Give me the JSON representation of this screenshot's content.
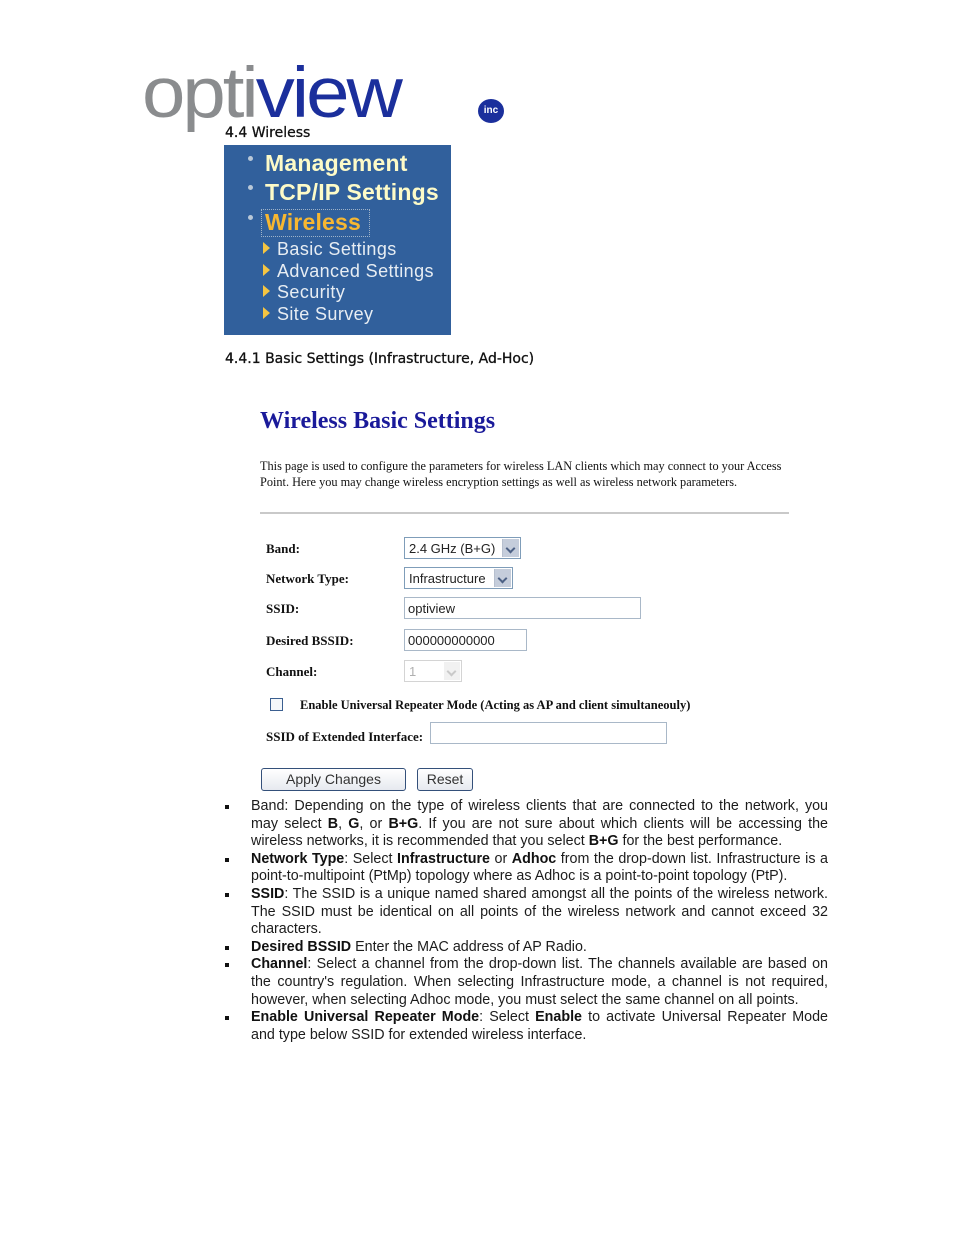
{
  "logo": {
    "part1": "opti",
    "part2": "view",
    "badge": "inc"
  },
  "colors": {
    "menu_bg": "#31609c",
    "menu_text": "#fdfbc8",
    "menu_active": "#f7b731",
    "logo_gray": "#8a8c8e",
    "logo_blue": "#1b2f9c",
    "form_title": "#1a1a9a"
  },
  "section": {
    "heading": "4.4 Wireless",
    "subheading": "4.4.1 Basic Settings (Infrastructure, Ad-Hoc)"
  },
  "menu": {
    "top_items": [
      {
        "label": "Management",
        "icon": "bullet-dot-icon",
        "active": false
      },
      {
        "label": "TCP/IP Settings",
        "icon": "bullet-dot-icon",
        "active": false
      },
      {
        "label": "Wireless",
        "icon": "bullet-dot-icon",
        "active": true
      }
    ],
    "sub_items": [
      {
        "label": "Basic Settings",
        "icon": "triangle-arrow-icon"
      },
      {
        "label": "Advanced Settings",
        "icon": "triangle-arrow-icon"
      },
      {
        "label": "Security",
        "icon": "triangle-arrow-icon"
      },
      {
        "label": "Site Survey",
        "icon": "triangle-arrow-icon"
      }
    ]
  },
  "form": {
    "title": "Wireless Basic Settings",
    "description": "This page is used to configure the parameters for wireless LAN clients which may connect to your Access Point. Here you may change wireless encryption settings as well as wireless network parameters.",
    "band": {
      "label": "Band:",
      "value": "2.4 GHz (B+G)"
    },
    "network_type": {
      "label": "Network Type:",
      "value": "Infrastructure"
    },
    "ssid": {
      "label": "SSID:",
      "value": "optiview"
    },
    "bssid": {
      "label": "Desired BSSID:",
      "value": "000000000000"
    },
    "channel": {
      "label": "Channel:",
      "value": "1",
      "disabled": true
    },
    "repeater": {
      "label": "Enable Universal Repeater Mode (Acting as AP and client simultaneouly)",
      "checked": false
    },
    "ext_ssid": {
      "label": "SSID of Extended Interface:",
      "value": ""
    },
    "apply_label": "Apply Changes",
    "reset_label": "Reset"
  },
  "descriptions": [
    {
      "parts": [
        {
          "t": "Band: Depending on the type of wireless clients that are connected to the network, you may select ",
          "b": false
        },
        {
          "t": "B",
          "b": true
        },
        {
          "t": ", ",
          "b": false
        },
        {
          "t": "G",
          "b": true
        },
        {
          "t": ", or ",
          "b": false
        },
        {
          "t": "B+G",
          "b": true
        },
        {
          "t": ". If you are not sure about which clients will be accessing the wireless networks, it is recommended that you select ",
          "b": false
        },
        {
          "t": "B+G",
          "b": true
        },
        {
          "t": " for the best performance.",
          "b": false
        }
      ]
    },
    {
      "parts": [
        {
          "t": "Network Type",
          "b": true
        },
        {
          "t": ": Select ",
          "b": false
        },
        {
          "t": "Infrastructure",
          "b": true
        },
        {
          "t": " or ",
          "b": false
        },
        {
          "t": "Adhoc",
          "b": true
        },
        {
          "t": " from the drop-down list. Infrastructure is a point-to-multipoint (PtMp) topology where as Adhoc is a point-to-point topology (PtP).",
          "b": false
        }
      ]
    },
    {
      "parts": [
        {
          "t": "SSID",
          "b": true
        },
        {
          "t": ": The SSID is a unique named shared amongst all the points of the wireless network. The SSID must be identical on all points of the wireless network and cannot exceed 32 characters.",
          "b": false
        }
      ]
    },
    {
      "parts": [
        {
          "t": "Desired BSSID",
          "b": true
        },
        {
          "t": " Enter the MAC address of AP Radio.",
          "b": false
        }
      ]
    },
    {
      "parts": [
        {
          "t": "Channel",
          "b": true
        },
        {
          "t": ": Select a channel from the drop-down list. The channels available are based on the country's regulation. When selecting Infrastructure mode, a channel is not required, however, when selecting Adhoc mode, you must select the same channel on all points.",
          "b": false
        }
      ]
    },
    {
      "parts": [
        {
          "t": "Enable Universal Repeater Mode",
          "b": true
        },
        {
          "t": ":  Select ",
          "b": false
        },
        {
          "t": "Enable",
          "b": true
        },
        {
          "t": " to activate Universal Repeater Mode and type below SSID for extended wireless interface.",
          "b": false
        }
      ]
    }
  ]
}
